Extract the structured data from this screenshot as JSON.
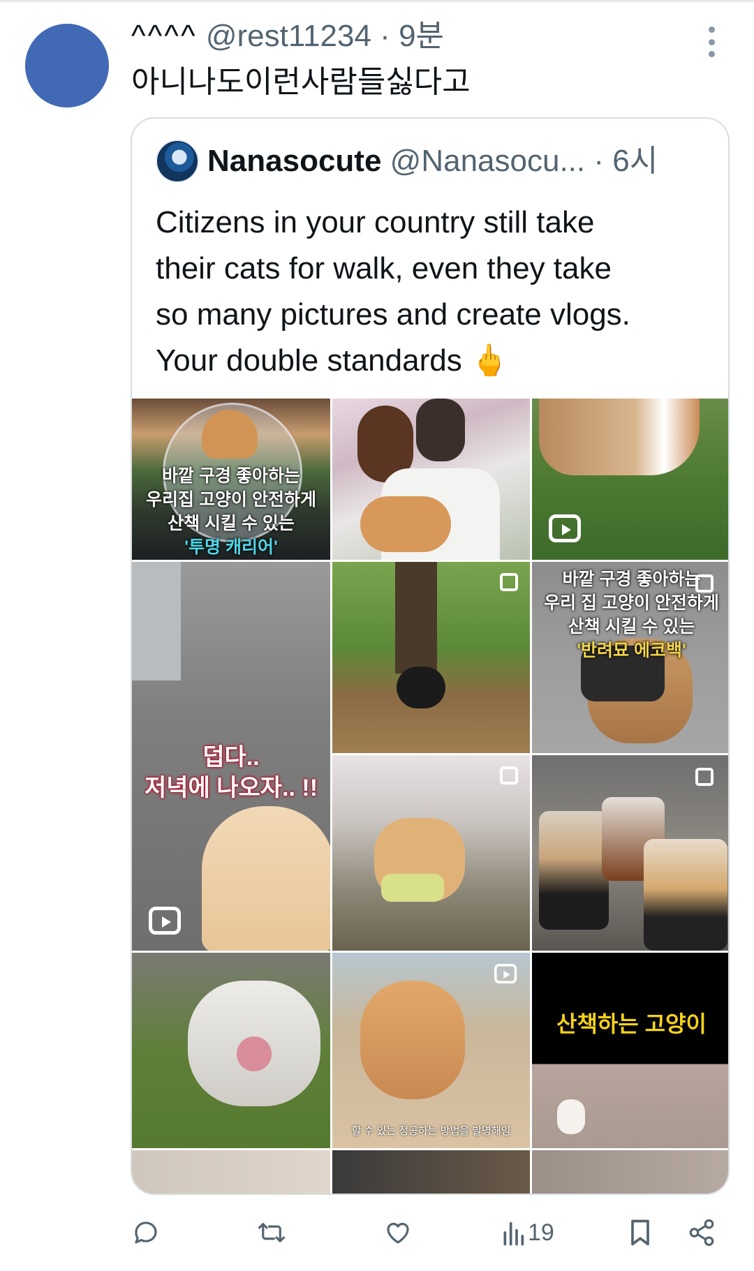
{
  "tweet": {
    "display_name": "^^^^",
    "handle": "@rest11234",
    "separator": "·",
    "time": "9분",
    "text": "아니나도이런사람들싫다고",
    "avatar_color": "#4169b5"
  },
  "quoted": {
    "display_name": "Nanasocute",
    "handle": "@Nanasocu...",
    "separator": "·",
    "time": "6시",
    "lines": [
      "Citizens in your country still take",
      "their cats for walk, even they take",
      "so many pictures and create vlogs.",
      "Your double standards 🖕"
    ]
  },
  "media": {
    "tile1": {
      "lines": [
        "바깥 구경 좋아하는",
        "우리집 고양이 안전하게",
        "산책 시킬 수 있는",
        "'투명 캐리어'"
      ],
      "highlight": "고양이",
      "highlight2": "'투명 캐리어'"
    },
    "tile6": {
      "lines": [
        "바깥 구경 좋아하는",
        "우리 집 고양이 안전하게",
        "산책 시킬 수 있는",
        "'반려묘 에코백'"
      ],
      "highlight": "고양이",
      "highlight2": "'반려묘 에코백'"
    },
    "tile4": {
      "lines": [
        "덥다..",
        "저녁에 나오자.. !!"
      ]
    },
    "tile12": {
      "text": "산책하는 고양이"
    },
    "tile11": {
      "caption": "할 수 있는 정공하는 방법을 발명해임"
    }
  },
  "actions": {
    "views_count": "19"
  },
  "colors": {
    "secondary_text": "#536471",
    "primary_text": "#0f1419",
    "border": "#d8dde2"
  },
  "icons": [
    "more-icon",
    "reply-icon",
    "retweet-icon",
    "like-icon",
    "views-icon",
    "bookmark-icon",
    "share-icon",
    "reel-icon",
    "multiple-images-icon"
  ]
}
